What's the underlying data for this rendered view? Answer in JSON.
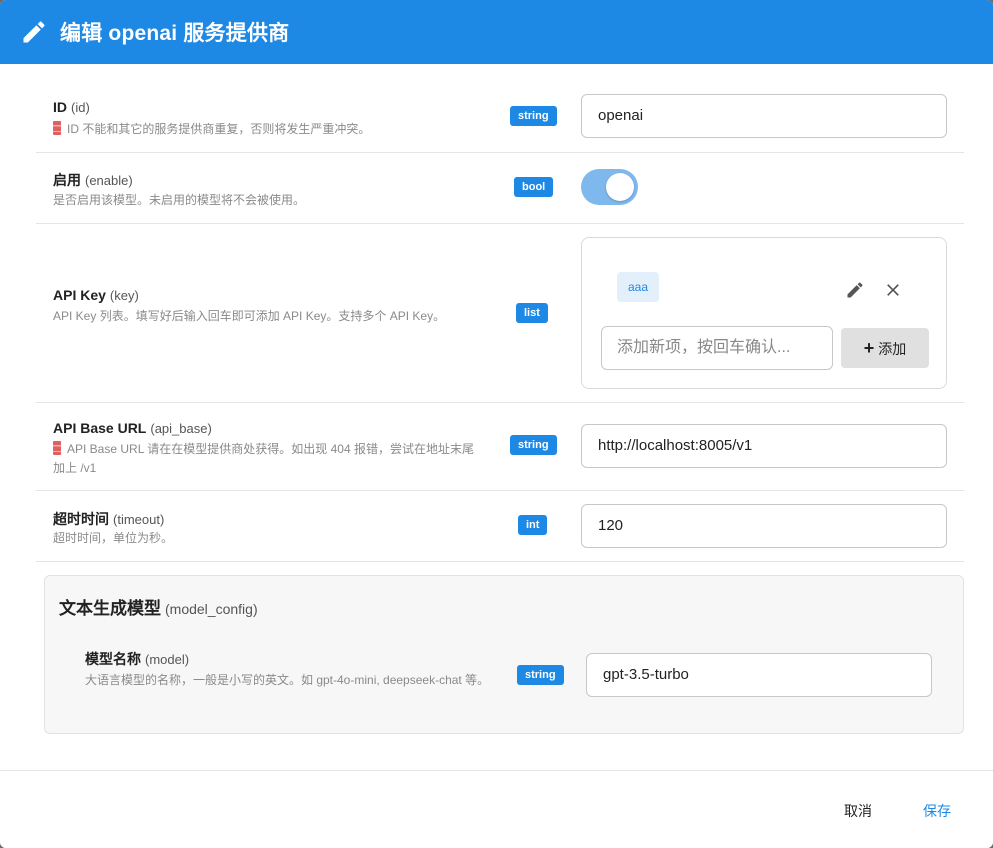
{
  "dialog": {
    "title": "编辑 openai 服务提供商"
  },
  "fields": {
    "id": {
      "label": "ID",
      "key": "(id)",
      "desc": "ID 不能和其它的服务提供商重复，否则将发生严重冲突。",
      "type": "string",
      "value": "openai"
    },
    "enable": {
      "label": "启用",
      "key": "(enable)",
      "desc": "是否启用该模型。未启用的模型将不会被使用。",
      "type": "bool",
      "value": true
    },
    "key": {
      "label": "API Key",
      "key": "(key)",
      "desc": "API Key 列表。填写好后输入回车即可添加 API Key。支持多个 API Key。",
      "type": "list",
      "items": [
        "aaa"
      ],
      "new_placeholder": "添加新项，按回车确认...",
      "add_label": "添加"
    },
    "api_base": {
      "label": "API Base URL",
      "key": "(api_base)",
      "desc": "API Base URL 请在在模型提供商处获得。如出现 404 报错，尝试在地址末尾加上 /v1",
      "type": "string",
      "value": "http://localhost:8005/v1"
    },
    "timeout": {
      "label": "超时时间",
      "key": "(timeout)",
      "desc": "超时时间，单位为秒。",
      "type": "int",
      "value": "120"
    }
  },
  "model_config": {
    "title": "文本生成模型",
    "key": "(model_config)",
    "model": {
      "label": "模型名称",
      "key": "(model)",
      "desc": "大语言模型的名称，一般是小写的英文。如 gpt-4o-mini, deepseek-chat 等。",
      "type": "string",
      "value": "gpt-3.5-turbo"
    }
  },
  "footer": {
    "cancel_label": "取消",
    "save_label": "保存"
  },
  "colors": {
    "primary": "#1e88e5",
    "toggle_track": "#7fb8ec",
    "tag_bg": "#e3effb"
  }
}
